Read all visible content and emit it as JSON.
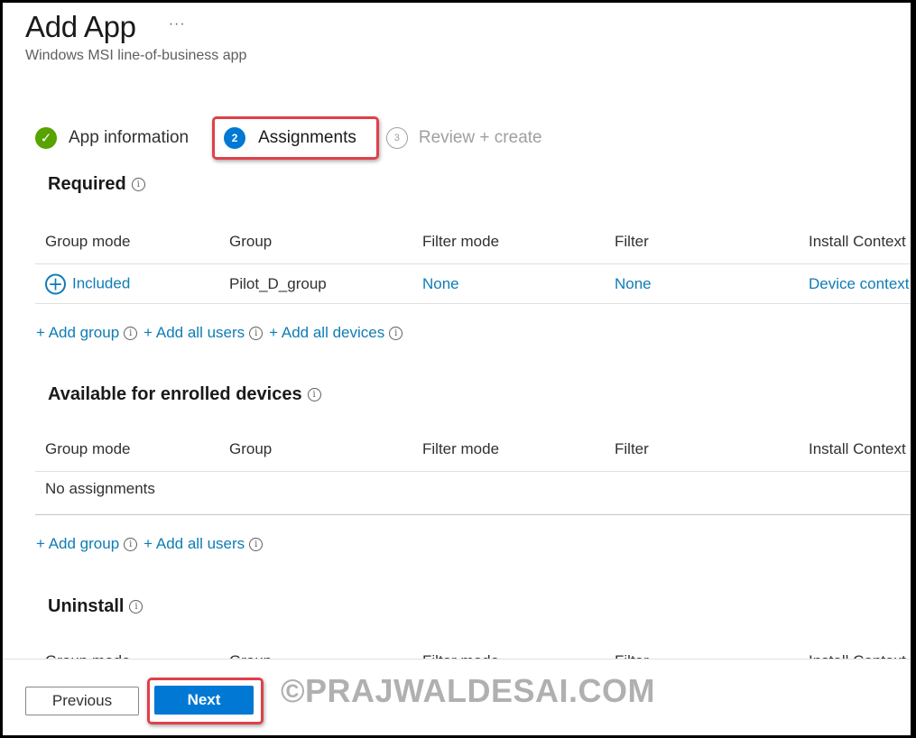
{
  "header": {
    "title": "Add App",
    "more_label": "···",
    "subtitle": "Windows MSI line-of-business app"
  },
  "wizard": {
    "steps": [
      {
        "number": "✓",
        "label": "App information",
        "state": "completed"
      },
      {
        "number": "2",
        "label": "Assignments",
        "state": "current"
      },
      {
        "number": "3",
        "label": "Review + create",
        "state": "upcoming"
      }
    ]
  },
  "columns": [
    "Group mode",
    "Group",
    "Filter mode",
    "Filter",
    "Install Context"
  ],
  "sections": {
    "required": {
      "title": "Required",
      "rows": [
        {
          "group_mode": "Included",
          "group": "Pilot_D_group",
          "filter_mode": "None",
          "filter": "None",
          "install_context": "Device context"
        }
      ],
      "actions": [
        "+ Add group",
        "+ Add all users",
        "+ Add all devices"
      ]
    },
    "available": {
      "title": "Available for enrolled devices",
      "empty_text": "No assignments",
      "actions": [
        "+ Add group",
        "+ Add all users"
      ]
    },
    "uninstall": {
      "title": "Uninstall"
    }
  },
  "info_glyph": "i",
  "footer": {
    "previous_label": "Previous",
    "next_label": "Next",
    "watermark": "©PRAJWALDESAI.COM"
  },
  "colors": {
    "accent": "#0078d4",
    "link": "#0f7cb5",
    "success": "#57a300",
    "highlight": "#e0404a"
  }
}
